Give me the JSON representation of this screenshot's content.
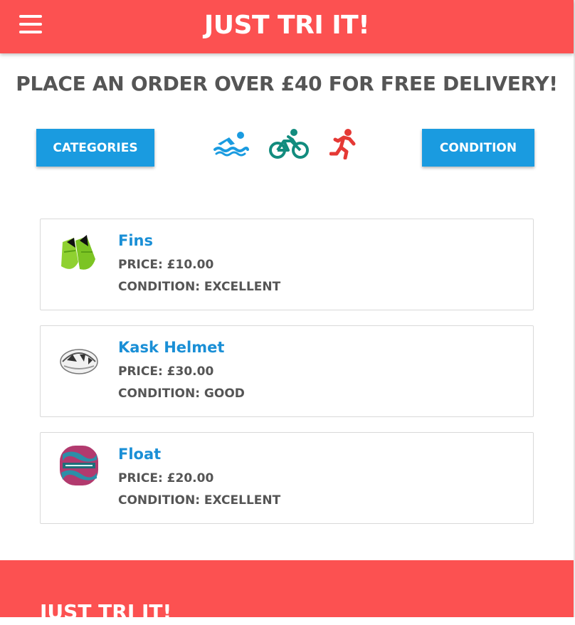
{
  "header": {
    "brand": "Just Tri It!",
    "menu_icon": "hamburger-menu-icon",
    "background": "#fc5151"
  },
  "promo": {
    "text": "Place an order over £40 for free delivery!"
  },
  "filters": {
    "categories_label": "Categories",
    "condition_label": "Condition",
    "sports": [
      {
        "icon": "swimming-icon",
        "color": "#1a9be0"
      },
      {
        "icon": "cycling-icon",
        "color": "#128c7e"
      },
      {
        "icon": "running-icon",
        "color": "#e53935"
      }
    ]
  },
  "products": [
    {
      "name": "Fins",
      "price": "Price: £10.00",
      "condition": "Condition: Excellent",
      "image": "fins-image"
    },
    {
      "name": "Kask Helmet",
      "price": "Price: £30.00",
      "condition": "Condition: Good",
      "image": "helmet-image"
    },
    {
      "name": "Float",
      "price": "Price: £20.00",
      "condition": "Condition: Excellent",
      "image": "float-image"
    }
  ],
  "footer": {
    "brand": "Just Tri It!"
  },
  "colors": {
    "accent": "#1a9be0",
    "brand": "#fc5151",
    "text": "#555555"
  }
}
